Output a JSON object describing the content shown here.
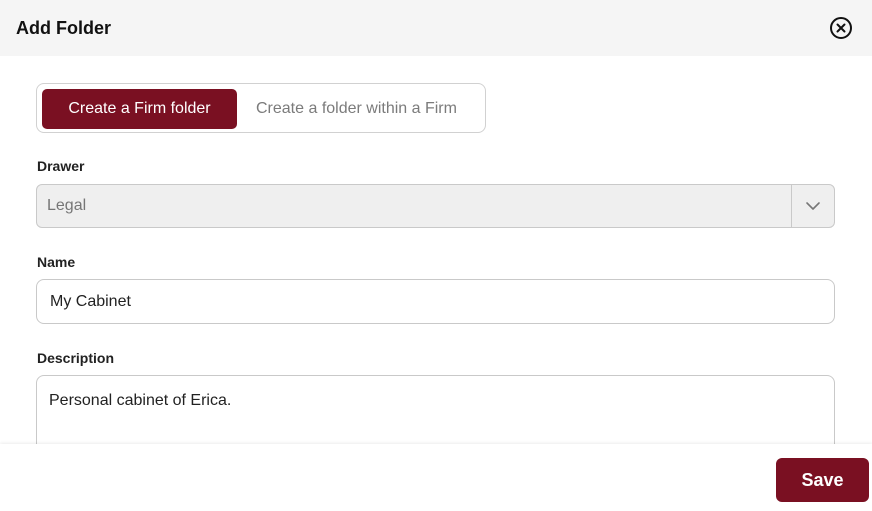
{
  "dialog": {
    "title": "Add Folder",
    "close_icon": "close-circle-icon"
  },
  "folder_type": {
    "options": [
      "Create a Firm folder",
      "Create a folder within a Firm"
    ],
    "selected": "Create a Firm folder"
  },
  "drawer": {
    "label": "Drawer",
    "value": "Legal",
    "icon": "chevron-down-icon"
  },
  "name": {
    "label": "Name",
    "value": "My Cabinet"
  },
  "description": {
    "label": "Description",
    "value": "Personal cabinet of Erica."
  },
  "footer": {
    "save_label": "Save"
  },
  "colors": {
    "accent": "#7a1022",
    "header_bg": "#f5f5f5",
    "disabled_bg": "#efefef"
  }
}
